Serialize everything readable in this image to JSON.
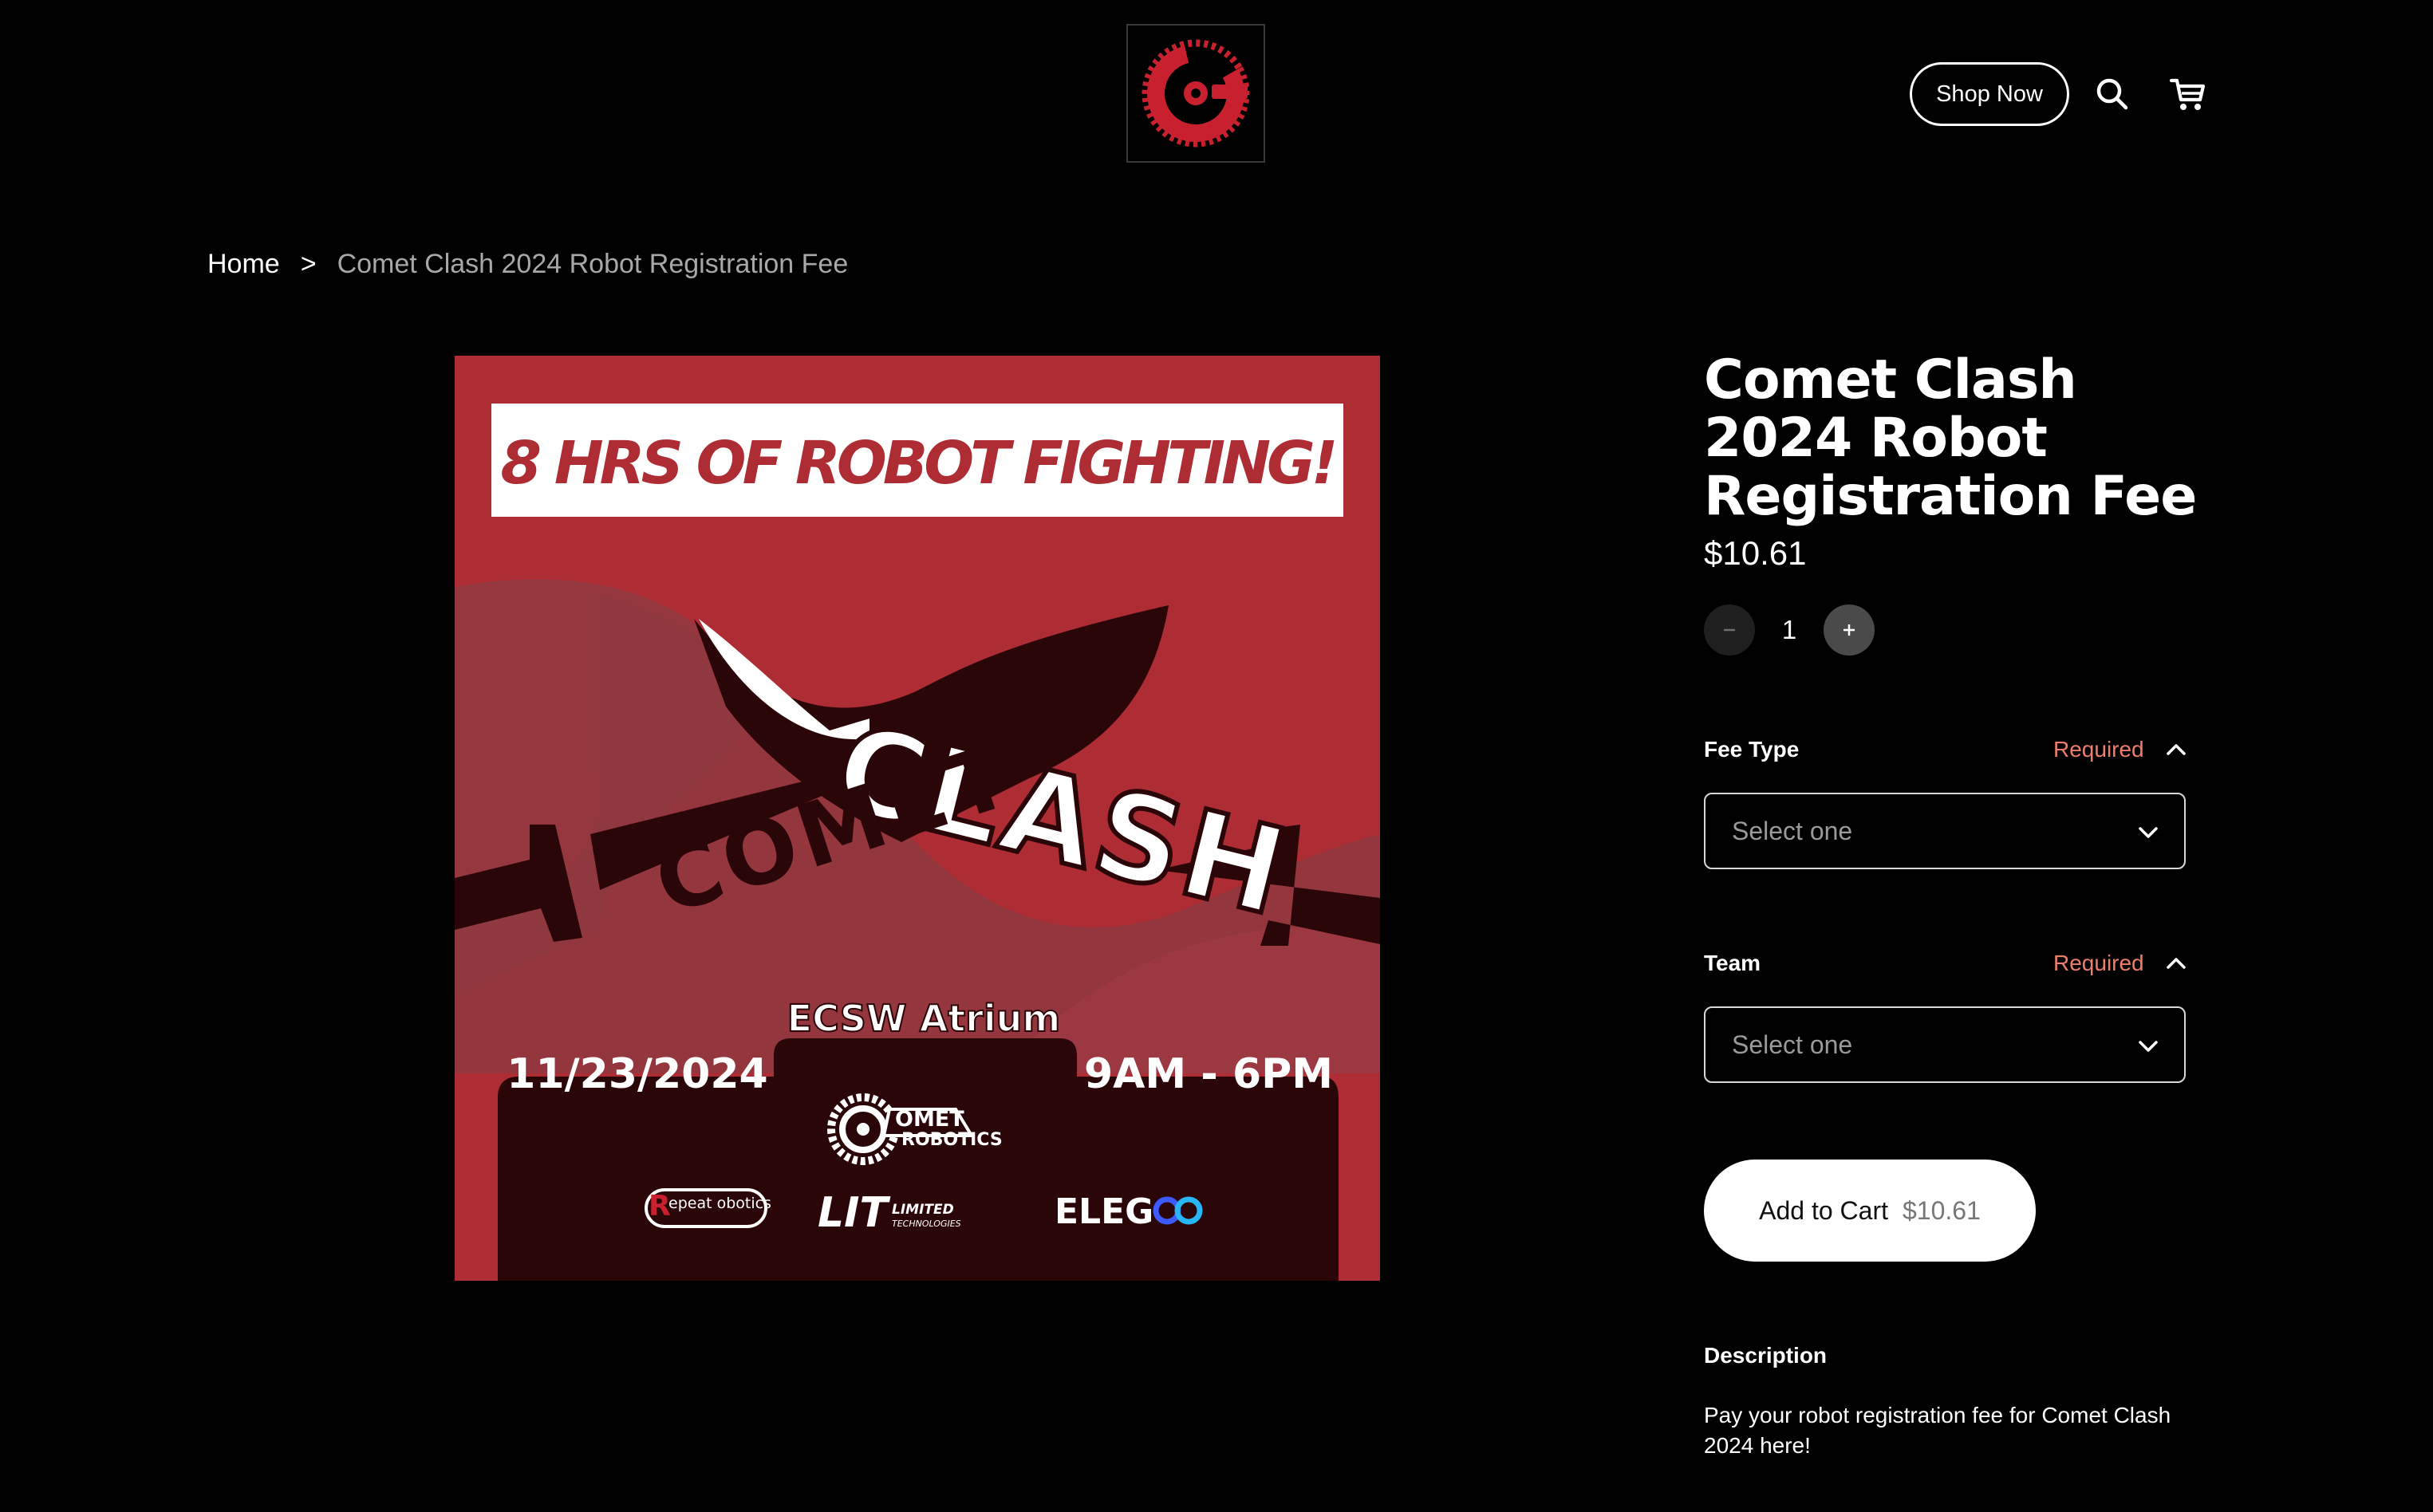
{
  "header": {
    "logo_alt": "Comet Robotics gear logo",
    "shop_now_label": "Shop Now",
    "search_icon": "search-icon",
    "cart_icon": "cart-icon"
  },
  "breadcrumb": {
    "home": "Home",
    "separator": ">",
    "current": "Comet Clash 2024 Robot Registration Fee"
  },
  "poster": {
    "banner": "8 HRS OF ROBOT FIGHTING!",
    "logo_words": [
      "COMET",
      "CLASH"
    ],
    "venue": "ECSW Atrium",
    "date": "11/23/2024",
    "time": "9AM - 6PM",
    "host_logo_top": "OMET",
    "host_logo_bottom": "ROBOTICS",
    "sponsor_1": "epeat obotics",
    "sponsor_2_main": "LIT",
    "sponsor_2_sub_1": "LIMITED",
    "sponsor_2_sub_2": "TECHNOLOGIES",
    "sponsor_3": "ELEG"
  },
  "product": {
    "title": "Comet Clash 2024 Robot Registration Fee",
    "price": "$10.61",
    "quantity": "1",
    "options": [
      {
        "label": "Fee Type",
        "required": "Required",
        "placeholder": "Select one"
      },
      {
        "label": "Team",
        "required": "Required",
        "placeholder": "Select one"
      }
    ],
    "add_to_cart_label": "Add to Cart",
    "add_to_cart_price": "$10.61",
    "description_heading": "Description",
    "description": "Pay your robot registration fee for Comet Clash 2024 here!"
  },
  "colors": {
    "background": "#000000",
    "poster_red": "#ae2d34",
    "poster_dark": "#2a0508",
    "required": "#ef7d6e",
    "brand_red": "#c8202e"
  }
}
